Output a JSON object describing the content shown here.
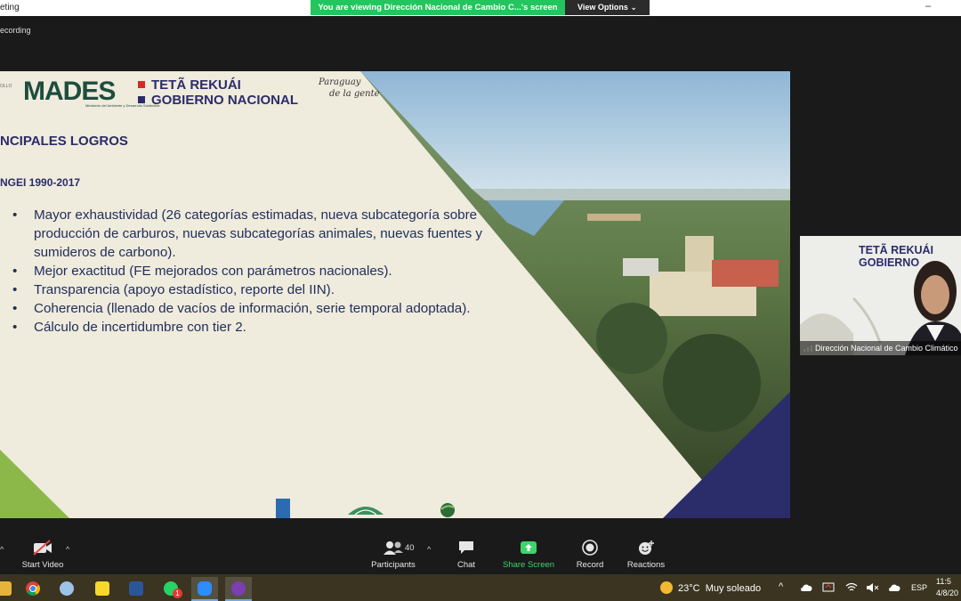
{
  "window": {
    "title": "eting",
    "share_banner": "You are viewing Dirección Nacional de Cambio C...'s screen",
    "view_options": "View Options ⌄",
    "recording": "ecording",
    "minimize": "–"
  },
  "slide": {
    "logo_mades": "MADES",
    "logo_mades_sub": "Ministerio del Ambiente y Desarrollo Sostenible",
    "logo_tag": "OLLO",
    "gov_line1": "TETÃ REKUÁI",
    "gov_line2": "GOBIERNO NACIONAL",
    "paraguay_line1": "Paraguay",
    "paraguay_line2": "de la gente",
    "title": "NCIPALES LOGROS",
    "subtitle": "NGEI 1990-2017",
    "bullets": [
      "Mayor exhaustividad (26 categorías estimadas, nueva subcategoría sobre producción de carburos, nuevas subcategorías animales, nuevas fuentes y sumideros de carbono).",
      "Mejor exactitud (FE mejorados con parámetros nacionales).",
      "Transparencia (apoyo estadístico, reporte del IIN).",
      "Coherencia (llenado de vacíos de información, serie temporal adoptada).",
      "Cálculo de incertidumbre con tier 2."
    ],
    "colors": {
      "navy": "#2b2c6a",
      "green": "#1d4d3e",
      "accent_green": "#8cb84a",
      "sky": "#a9cbe0"
    }
  },
  "participant_video": {
    "gov_line1": "TETÃ REKUÁI",
    "gov_line2": "GOBIERNO",
    "name": "Dirección Nacional de Cambio Climático"
  },
  "controls": {
    "start_video": "Start Video",
    "participants": "Participants",
    "participants_count": "40",
    "chat": "Chat",
    "share_screen": "Share Screen",
    "record": "Record",
    "reactions": "Reactions"
  },
  "taskbar": {
    "apps": [
      "folder-icon",
      "chrome-icon",
      "paint-icon",
      "sticky-notes-icon",
      "word-icon",
      "whatsapp-icon",
      "zoom-icon",
      "app-icon"
    ],
    "whatsapp_badge": "1",
    "weather_temp": "23°C",
    "weather_desc": "Muy soleado",
    "language": "ESP",
    "time": "11:5",
    "date": "4/8/20"
  }
}
